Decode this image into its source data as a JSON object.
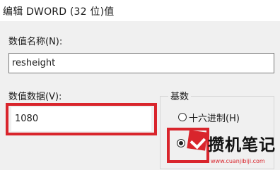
{
  "dialog": {
    "title": "编辑 DWORD (32 位)值"
  },
  "value_name": {
    "label": "数值名称(N):",
    "value": "resheight"
  },
  "value_data": {
    "label": "数值数据(V):",
    "value": "1080"
  },
  "base": {
    "group_label": "基数",
    "options": [
      {
        "label": "十六进制(H)",
        "selected": false
      },
      {
        "label": "",
        "selected": true
      }
    ]
  },
  "watermark": {
    "text": "攒机笔记",
    "url": "www.cuanjibiji.com"
  },
  "colors": {
    "highlight": "#d9252c",
    "background": "#f0f0f0"
  }
}
